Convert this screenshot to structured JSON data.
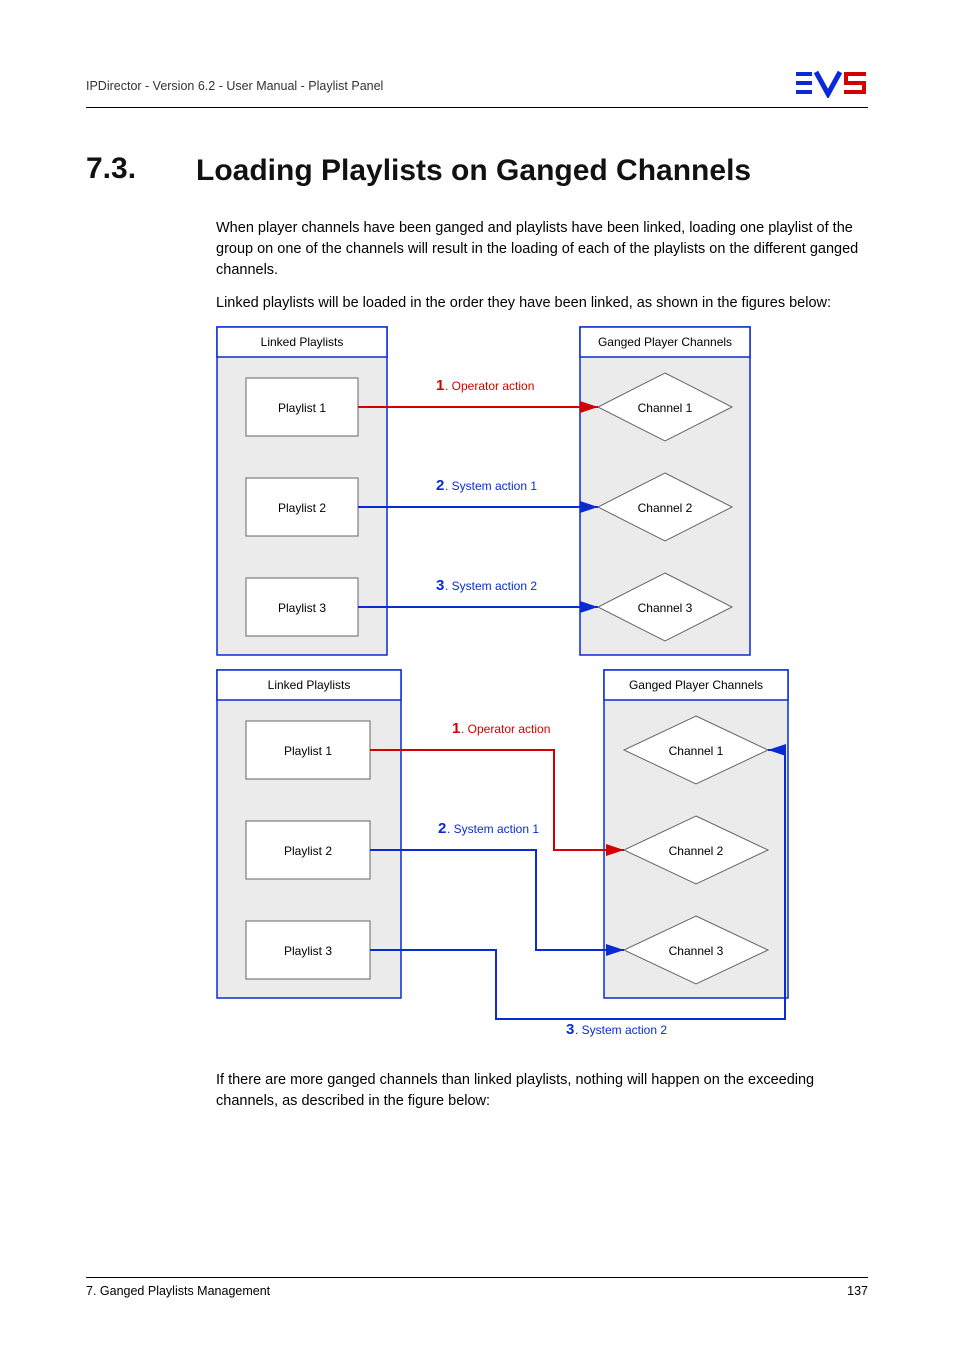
{
  "header": {
    "doc_title": "IPDirector - Version 6.2 - User Manual - Playlist Panel"
  },
  "section": {
    "number": "7.3.",
    "title": "Loading Playlists on Ganged Channels"
  },
  "paragraphs": {
    "p1": "When player channels have been ganged and playlists have been linked, loading one playlist of the group on one of the channels will result in the loading of each of the playlists on the different ganged channels.",
    "p2": "Linked playlists will be loaded in the order they have been linked, as shown in the figures below:",
    "p3": "If there are more ganged channels than linked playlists, nothing will happen on the exceeding channels, as described in the figure below:"
  },
  "diagram1": {
    "left_header": "Linked Playlists",
    "right_header": "Ganged Player Channels",
    "rows": [
      {
        "playlist": "Playlist 1",
        "num": "1",
        "label": ". Operator action",
        "color": "#d40000",
        "channel": "Channel 1"
      },
      {
        "playlist": "Playlist 2",
        "num": "2",
        "label": ". System action 1",
        "color": "#0a2bd4",
        "channel": "Channel 2"
      },
      {
        "playlist": "Playlist 3",
        "num": "3",
        "label": ". System action 2",
        "color": "#0a2bd4",
        "channel": "Channel 3"
      }
    ]
  },
  "diagram2": {
    "left_header": "Linked Playlists",
    "right_header": "Ganged Player Channels",
    "playlists": [
      "Playlist 1",
      "Playlist 2",
      "Playlist 3"
    ],
    "channels": [
      "Channel 1",
      "Channel 2",
      "Channel 3"
    ],
    "action1_num": "1",
    "action1_label": ". Operator action",
    "action2_num": "2",
    "action2_label": ". System action 1",
    "action3_num": "3",
    "action3_label": ". System action 2"
  },
  "footer": {
    "chapter": "7. Ganged Playlists Management",
    "page": "137"
  }
}
